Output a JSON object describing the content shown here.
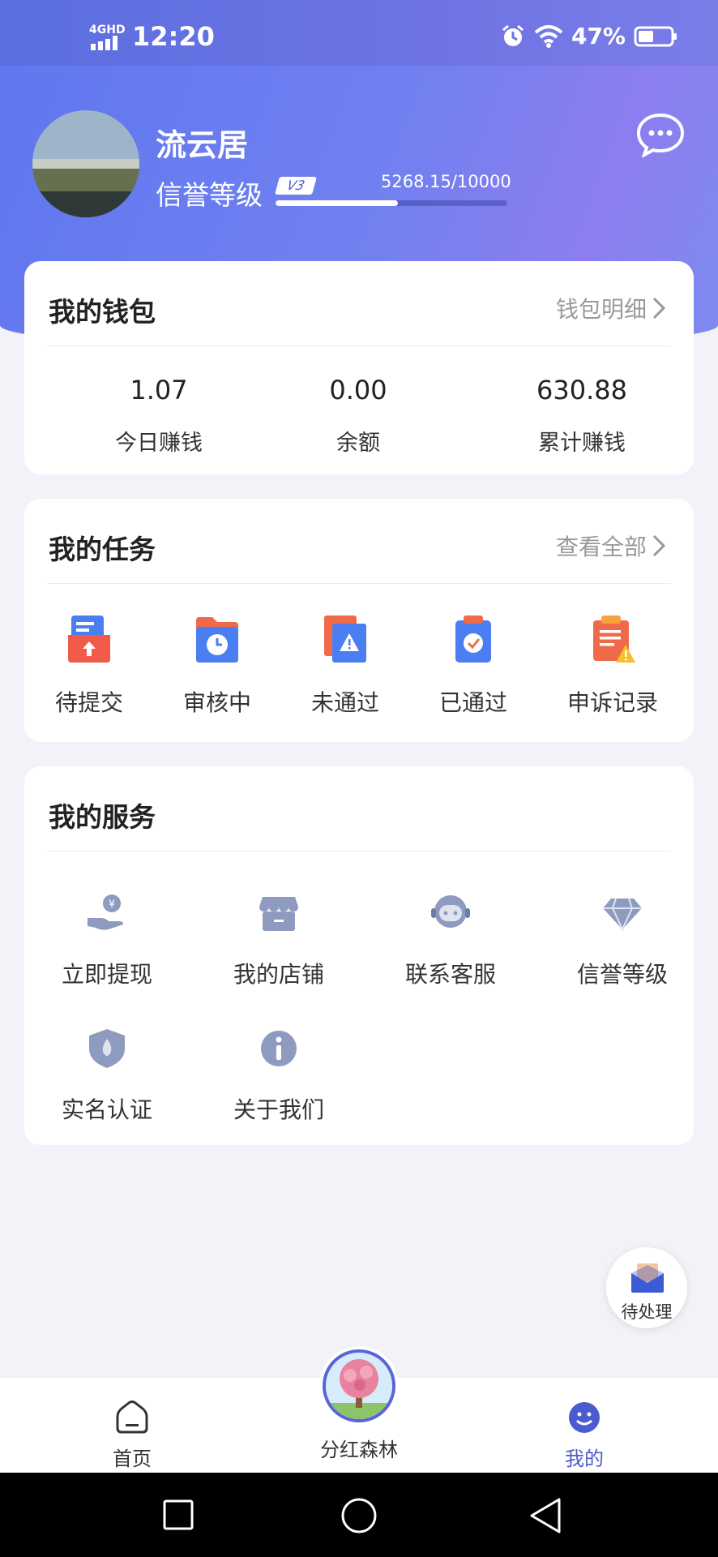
{
  "status_bar": {
    "network": "4GHD",
    "time": "12:20",
    "battery": "47%"
  },
  "profile": {
    "name": "流云居",
    "credit_label": "信誉等级",
    "level": "V3",
    "score": "5268.15/10000",
    "score_progress": 0.5268
  },
  "wallet": {
    "title": "我的钱包",
    "link": "钱包明细",
    "stats": [
      {
        "value": "1.07",
        "label": "今日赚钱"
      },
      {
        "value": "0.00",
        "label": "余额"
      },
      {
        "value": "630.88",
        "label": "累计赚钱"
      }
    ]
  },
  "tasks": {
    "title": "我的任务",
    "link": "查看全部",
    "items": [
      {
        "label": "待提交",
        "icon": "upload-folder-icon"
      },
      {
        "label": "审核中",
        "icon": "clock-folder-icon"
      },
      {
        "label": "未通过",
        "icon": "warning-doc-icon"
      },
      {
        "label": "已通过",
        "icon": "check-clipboard-icon"
      },
      {
        "label": "申诉记录",
        "icon": "appeal-clipboard-icon"
      }
    ]
  },
  "services": {
    "title": "我的服务",
    "items": [
      {
        "label": "立即提现",
        "icon": "withdraw-icon"
      },
      {
        "label": "我的店铺",
        "icon": "shop-icon"
      },
      {
        "label": "联系客服",
        "icon": "customer-service-icon"
      },
      {
        "label": "信誉等级",
        "icon": "diamond-icon"
      },
      {
        "label": "实名认证",
        "icon": "shield-icon"
      },
      {
        "label": "关于我们",
        "icon": "info-icon"
      }
    ]
  },
  "pending": {
    "label": "待处理"
  },
  "tabbar": {
    "home": "首页",
    "forest": "分红森林",
    "mine": "我的"
  },
  "colors": {
    "accent": "#5b6fe0",
    "active_tab": "#4b5bd0"
  }
}
